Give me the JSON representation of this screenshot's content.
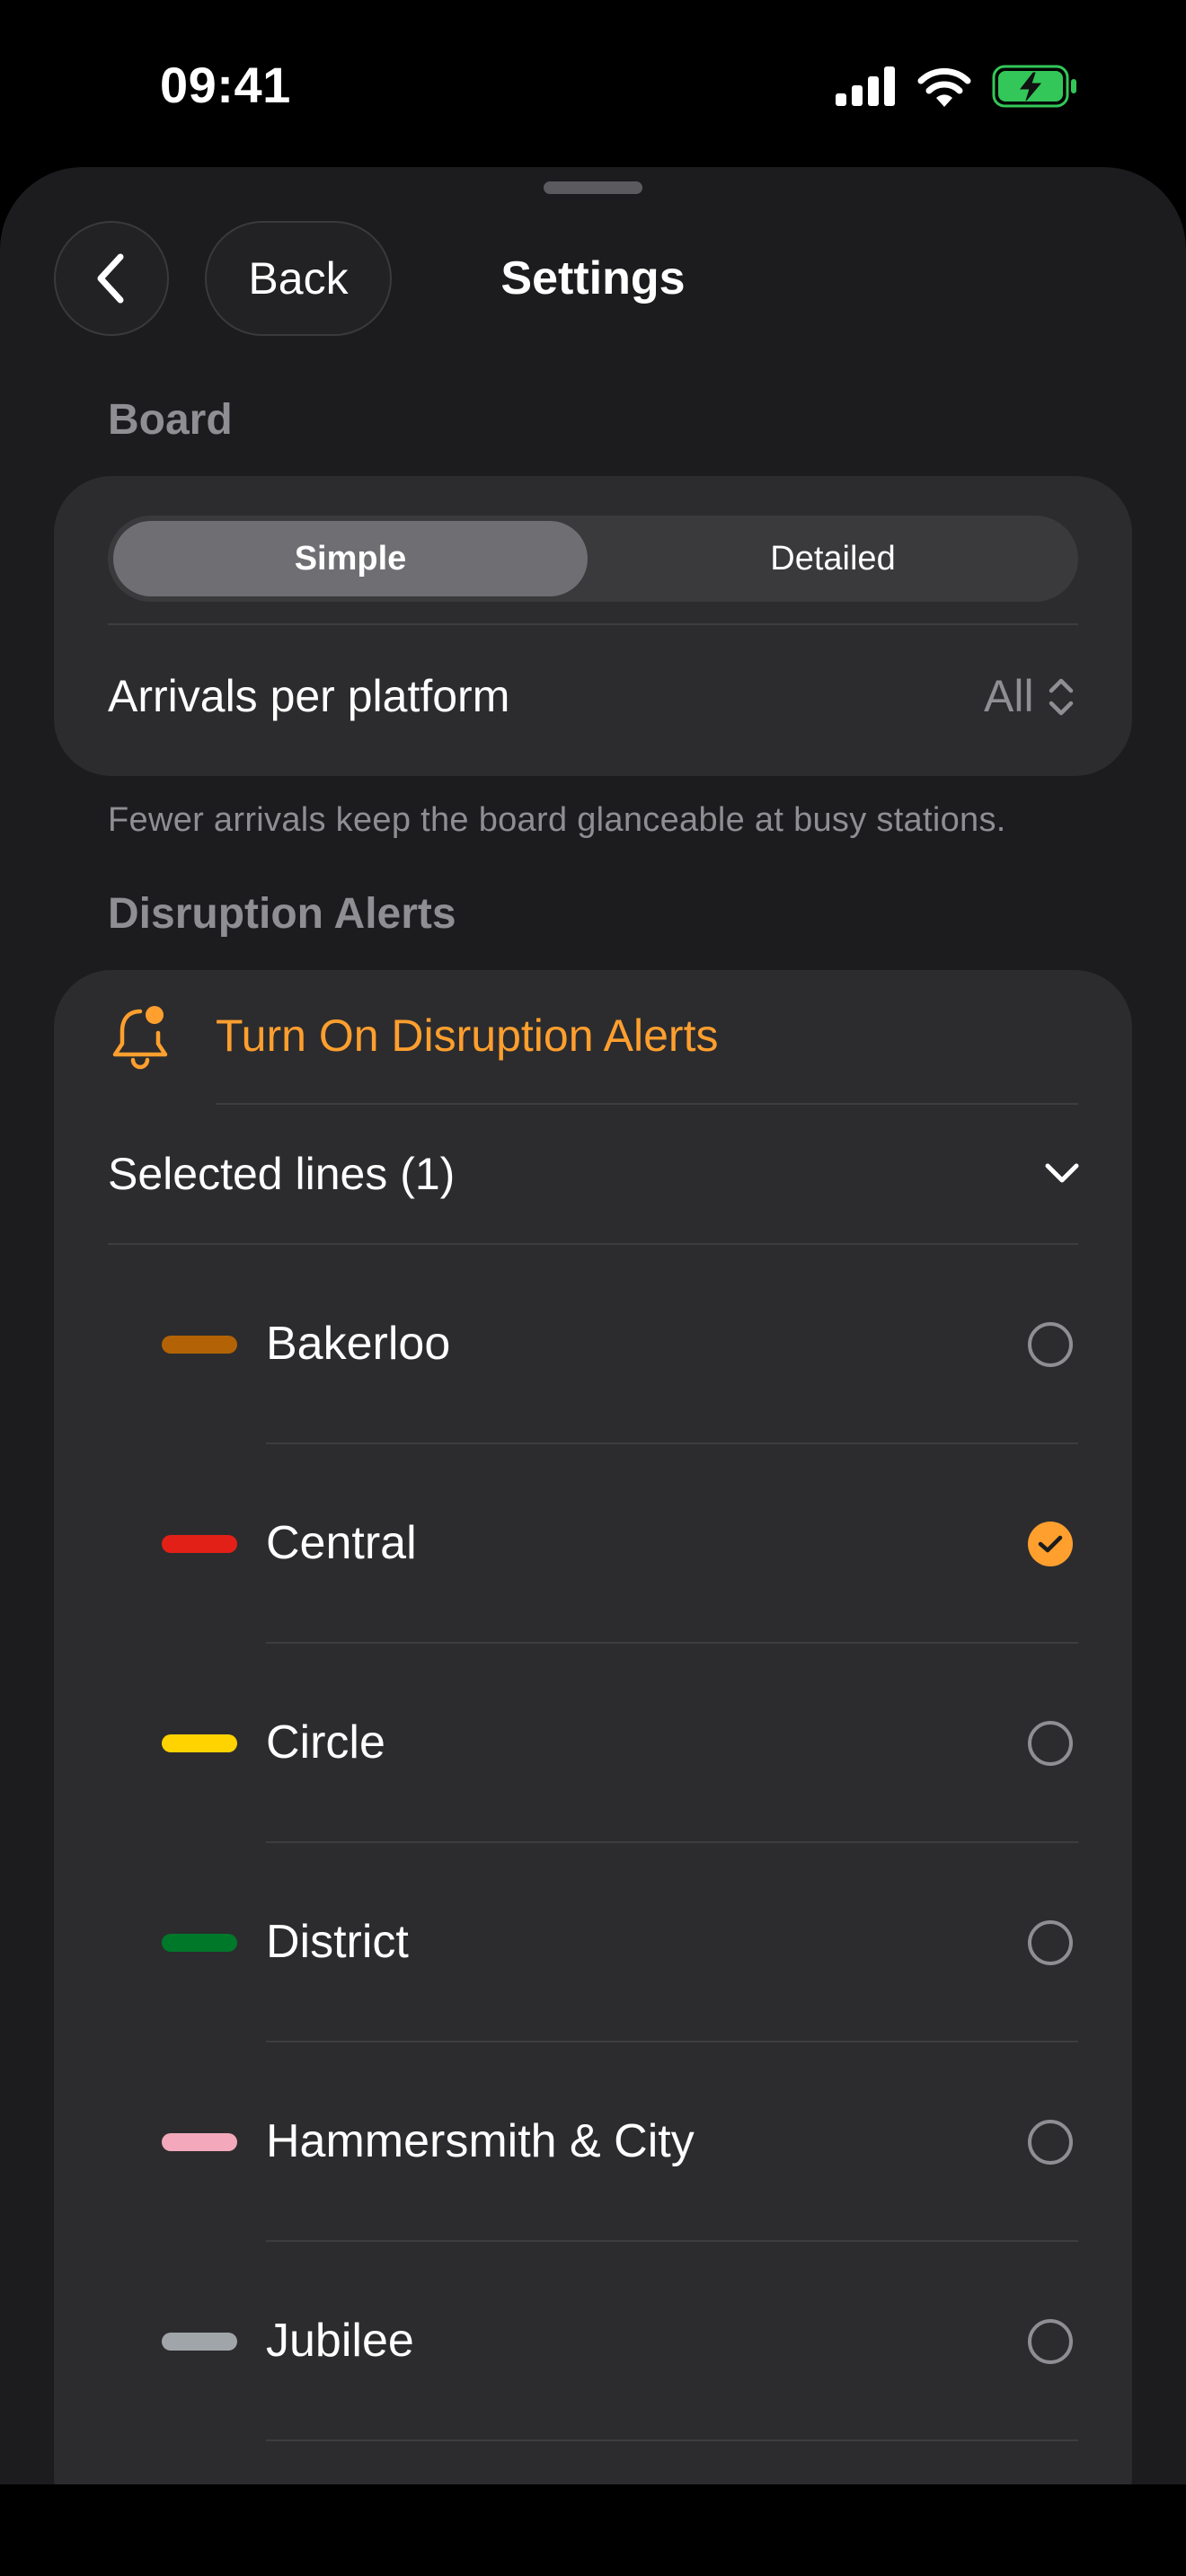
{
  "status_bar": {
    "time": "09:41"
  },
  "nav": {
    "back_icon": "chevron-left-icon",
    "back_label": "Back",
    "title": "Settings"
  },
  "board": {
    "header": "Board",
    "segments": [
      "Simple",
      "Detailed"
    ],
    "selected_segment": "Simple",
    "arrivals_label": "Arrivals per platform",
    "arrivals_value": "All",
    "footnote": "Fewer arrivals keep the board glanceable at busy stations."
  },
  "disruption": {
    "header": "Disruption Alerts",
    "turn_on_label": "Turn On Disruption Alerts",
    "accent_color": "#ff9f2e",
    "selected_lines_label": "Selected lines (1)",
    "lines": [
      {
        "name": "Bakerloo",
        "color": "#b36305",
        "checked": false
      },
      {
        "name": "Central",
        "color": "#e32017",
        "checked": true
      },
      {
        "name": "Circle",
        "color": "#ffd300",
        "checked": false
      },
      {
        "name": "District",
        "color": "#00782a",
        "checked": false
      },
      {
        "name": "Hammersmith & City",
        "color": "#f3a9bb",
        "checked": false
      },
      {
        "name": "Jubilee",
        "color": "#a0a5a9",
        "checked": false
      }
    ]
  }
}
